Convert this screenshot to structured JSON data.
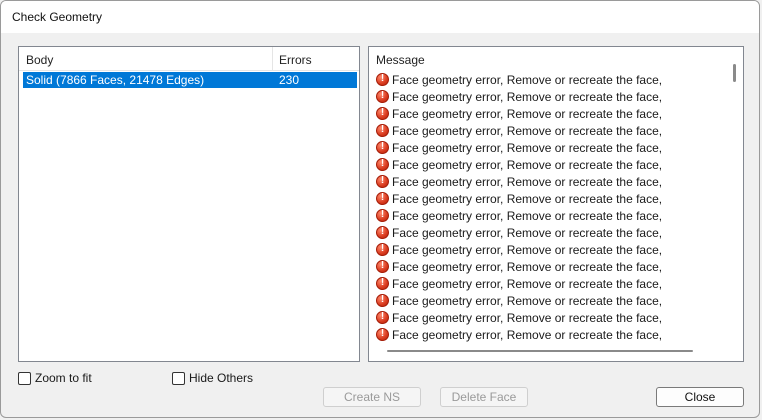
{
  "window": {
    "title": "Check Geometry"
  },
  "body_list": {
    "headers": {
      "body": "Body",
      "errors": "Errors"
    },
    "rows": [
      {
        "body": "Solid (7866 Faces, 21478 Edges)",
        "errors": "230",
        "selected": true
      }
    ]
  },
  "messages": {
    "header": "Message",
    "icon": "error-icon",
    "items": [
      "Face geometry error, Remove or recreate the face,",
      "Face geometry error, Remove or recreate the face,",
      "Face geometry error, Remove or recreate the face,",
      "Face geometry error, Remove or recreate the face,",
      "Face geometry error, Remove or recreate the face,",
      "Face geometry error, Remove or recreate the face,",
      "Face geometry error, Remove or recreate the face,",
      "Face geometry error, Remove or recreate the face,",
      "Face geometry error, Remove or recreate the face,",
      "Face geometry error, Remove or recreate the face,",
      "Face geometry error, Remove or recreate the face,",
      "Face geometry error, Remove or recreate the face,",
      "Face geometry error, Remove or recreate the face,",
      "Face geometry error, Remove or recreate the face,",
      "Face geometry error, Remove or recreate the face,",
      "Face geometry error, Remove or recreate the face,"
    ]
  },
  "options": {
    "zoom_to_fit": {
      "label": "Zoom to fit",
      "checked": false
    },
    "hide_others": {
      "label": "Hide Others",
      "checked": false
    }
  },
  "buttons": {
    "create_ns": {
      "label": "Create NS",
      "enabled": false
    },
    "delete_face": {
      "label": "Delete Face",
      "enabled": false
    },
    "close": {
      "label": "Close",
      "enabled": true
    }
  },
  "colors": {
    "selection": "#0078d7",
    "error_icon": "#d93a1e"
  }
}
